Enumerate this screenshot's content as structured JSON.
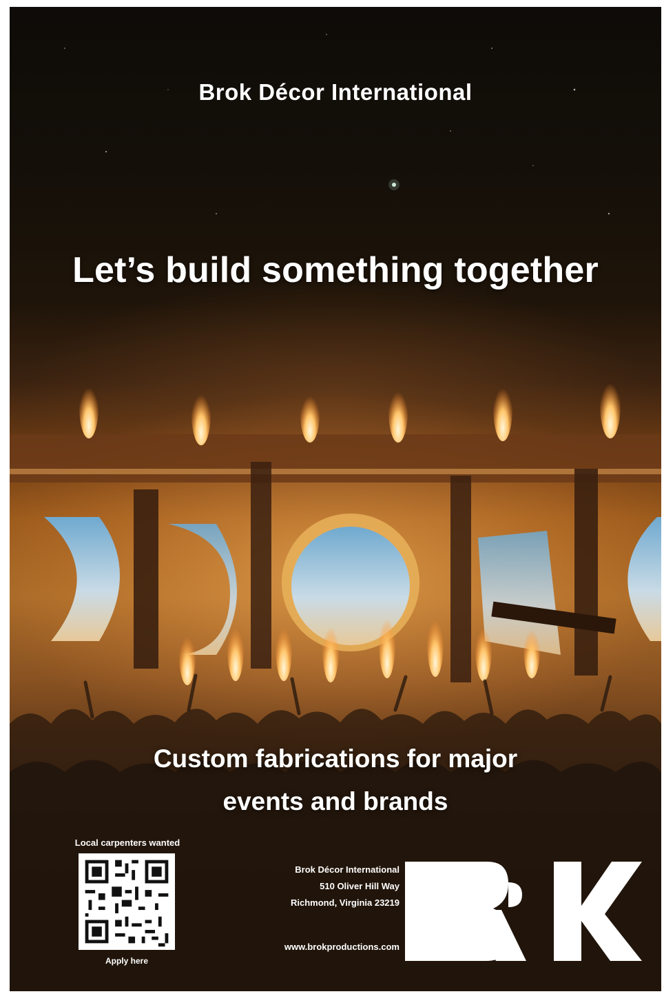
{
  "brand": {
    "name": "Brok Décor International"
  },
  "headline": "Let’s build something together",
  "tagline": {
    "line1": "Custom fabrications for major",
    "line2": "events and brands"
  },
  "recruit": {
    "label": "Local carpenters wanted",
    "cta": "Apply here"
  },
  "contact": {
    "company": "Brok Décor International",
    "street": "510 Oliver Hill Way",
    "city": "Richmond, Virginia 23219",
    "website": "www.brokproductions.com"
  },
  "logo": {
    "text": "BRK"
  },
  "colors": {
    "text": "#ffffff",
    "flame": "#ffb347",
    "sky": "#0e0b08"
  }
}
